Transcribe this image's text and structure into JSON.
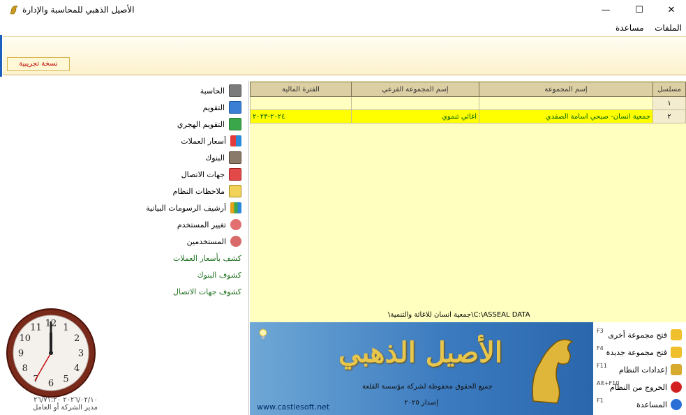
{
  "window": {
    "title": "الأصيل الذهبي للمحاسبة والإدارة",
    "minimize": "—",
    "maximize": "☐",
    "close": "✕"
  },
  "menu": {
    "files": "الملفات",
    "help": "مساعدة"
  },
  "ribbon": {
    "trial_label": "نسخة تجريبية"
  },
  "nav": {
    "items": [
      {
        "label": "الحاسبة",
        "icon": "calculator-icon"
      },
      {
        "label": "التقويم",
        "icon": "calendar-icon"
      },
      {
        "label": "التقويم الهجري",
        "icon": "hijri-calendar-icon"
      },
      {
        "label": "أسعار العملات",
        "icon": "currency-icon"
      },
      {
        "label": "البنوك",
        "icon": "bank-icon"
      },
      {
        "label": "جهات الاتصال",
        "icon": "contacts-icon"
      },
      {
        "label": "ملاحظات النظام",
        "icon": "notes-icon"
      },
      {
        "label": "أرشيف الرسومات البيانية",
        "icon": "charts-archive-icon"
      },
      {
        "label": "تغيير المستخدم",
        "icon": "change-user-icon"
      },
      {
        "label": "المستخدمين",
        "icon": "users-icon"
      }
    ],
    "links": [
      "كشف بأسعار العملات",
      "كشوف البنوك",
      "كشوف جهات الاتصال"
    ]
  },
  "clock": {
    "hour": 12,
    "minute": 0,
    "second": 35
  },
  "footer_left": {
    "line1": "٢٠٢٦/٠٢/١٠ ٢٦/٧١:٢٠",
    "line2": "مدير الشركة أو العامل"
  },
  "grid": {
    "headers": [
      "مسلسل",
      "إسم المجموعة",
      "إسم المجموعة الفرعي",
      "الفترة المالية"
    ],
    "rows": [
      [
        "١",
        "",
        "",
        ""
      ],
      [
        "٢",
        "جمعية انسان- صبحي اسامة الصفدي",
        "اغاثي تنموي",
        "٢٠٢٤-٢٠٢٣"
      ]
    ],
    "path": "C:\\ASSEAL DATA\\جمعية انسان للاغاثة والتنمية\\"
  },
  "banner": {
    "brand": "الأصيل الذهبي",
    "rights": "جميع الحقوق محفوظة لشركة مؤسسة القلعة",
    "version": "إصدار ٢٠٢٥",
    "url": "www.castlesoft.net"
  },
  "actions": [
    {
      "label": "فتح مجموعة أخرى",
      "key": "F3",
      "icon": "open-folder-icon",
      "color": "#f0c02c"
    },
    {
      "label": "فتح مجموعة جديدة",
      "key": "F4",
      "icon": "new-folder-icon",
      "color": "#f0c02c"
    },
    {
      "label": "إعدادات النظام",
      "key": "F11",
      "icon": "settings-icon",
      "color": "#d7a92c"
    },
    {
      "label": "الخروج من النظام",
      "key": "Alt+F10",
      "icon": "power-icon",
      "color": "#d22020"
    },
    {
      "label": "المساعدة",
      "key": "F1",
      "icon": "help-icon",
      "color": "#2a6fd6"
    }
  ]
}
